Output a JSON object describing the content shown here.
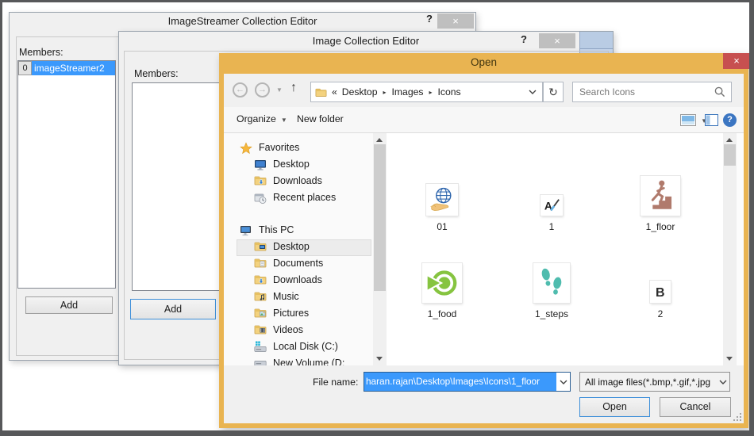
{
  "editor1": {
    "title": "ImageStreamer Collection Editor",
    "help_glyph": "?",
    "close_glyph": "×",
    "members_label": "Members:",
    "item_index": "0",
    "item_name": "imageStreamer2",
    "add_label": "Add"
  },
  "editor2": {
    "title": "Image Collection Editor",
    "help_glyph": "?",
    "close_glyph": "×",
    "members_label": "Members:",
    "add_label": "Add"
  },
  "open": {
    "title": "Open",
    "close_glyph": "×",
    "nav": {
      "back_glyph": "←",
      "fwd_glyph": "→",
      "up_glyph": "↑",
      "refresh_glyph": "↻",
      "breadcrumb_prefix": "«",
      "crumb_separator": "▸",
      "crumbs": [
        "Desktop",
        "Images",
        "Icons"
      ]
    },
    "search": {
      "placeholder": "Search Icons"
    },
    "toolbar": {
      "organize": "Organize",
      "new_folder": "New folder"
    },
    "sidebar": {
      "favorites_label": "Favorites",
      "favorites": [
        {
          "label": "Desktop"
        },
        {
          "label": "Downloads"
        },
        {
          "label": "Recent places"
        }
      ],
      "thispc_label": "This PC",
      "selected_item": "Desktop",
      "thispc": [
        {
          "label": "Desktop"
        },
        {
          "label": "Documents"
        },
        {
          "label": "Downloads"
        },
        {
          "label": "Music"
        },
        {
          "label": "Pictures"
        },
        {
          "label": "Videos"
        },
        {
          "label": "Local Disk (C:)"
        },
        {
          "label": "New Volume (D:"
        }
      ]
    },
    "files": [
      {
        "label": "01",
        "icon": "globe-hand"
      },
      {
        "label": "1",
        "icon": "letter-a-pen"
      },
      {
        "label": "1_floor",
        "icon": "stairs-person"
      },
      {
        "label": "1_food",
        "icon": "green-circle-arrow"
      },
      {
        "label": "1_steps",
        "icon": "footprints"
      },
      {
        "label": "2",
        "icon": "letter-b"
      }
    ],
    "filename_label": "File name:",
    "filename_value": "haran.rajan\\Desktop\\Images\\Icons\\1_floor",
    "filetype_value": "All image files(*.bmp,*.gif,*.jpg",
    "open_label": "Open",
    "cancel_label": "Cancel",
    "colors": {
      "accent_gold": "#e9b451",
      "selection_blue": "#3b99fc",
      "close_red": "#c75050"
    }
  }
}
